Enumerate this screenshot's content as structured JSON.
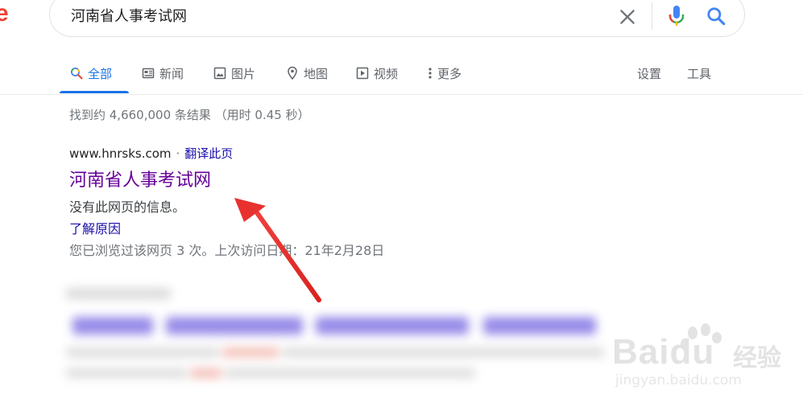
{
  "logo": {
    "fragment": "e",
    "color": "#ea4335"
  },
  "search": {
    "query": "河南省人事考试网",
    "clear_icon": "close-icon",
    "voice_icon": "microphone-icon",
    "submit_icon": "search-icon"
  },
  "tabs": [
    {
      "label": "全部",
      "icon": "search-icon",
      "active": true
    },
    {
      "label": "新闻",
      "icon": "newspaper-icon",
      "active": false
    },
    {
      "label": "图片",
      "icon": "image-icon",
      "active": false
    },
    {
      "label": "地图",
      "icon": "map-pin-icon",
      "active": false
    },
    {
      "label": "视频",
      "icon": "video-icon",
      "active": false
    },
    {
      "label": "更多",
      "icon": "more-vertical-icon",
      "active": false
    }
  ],
  "tools": {
    "settings": "设置",
    "tools": "工具"
  },
  "results": {
    "stats": "找到约 4,660,000 条结果 （用时 0.45 秒）",
    "first": {
      "url": "www.hnrsks.com",
      "separator": "·",
      "translate": "翻译此页",
      "title": "河南省人事考试网",
      "snippet": "没有此网页的信息。",
      "learn_why": "了解原因",
      "visit_info": "您已浏览过该网页 3 次。上次访问日期：21年2月28日"
    }
  },
  "watermark": {
    "brand": "Baidu",
    "cn": "经验",
    "url": "jingyan.baidu.com"
  },
  "colors": {
    "accent": "#1a73e8",
    "visited_link": "#660099",
    "link": "#1a0dab",
    "muted": "#70757a",
    "annotation_arrow": "#e8312f"
  }
}
